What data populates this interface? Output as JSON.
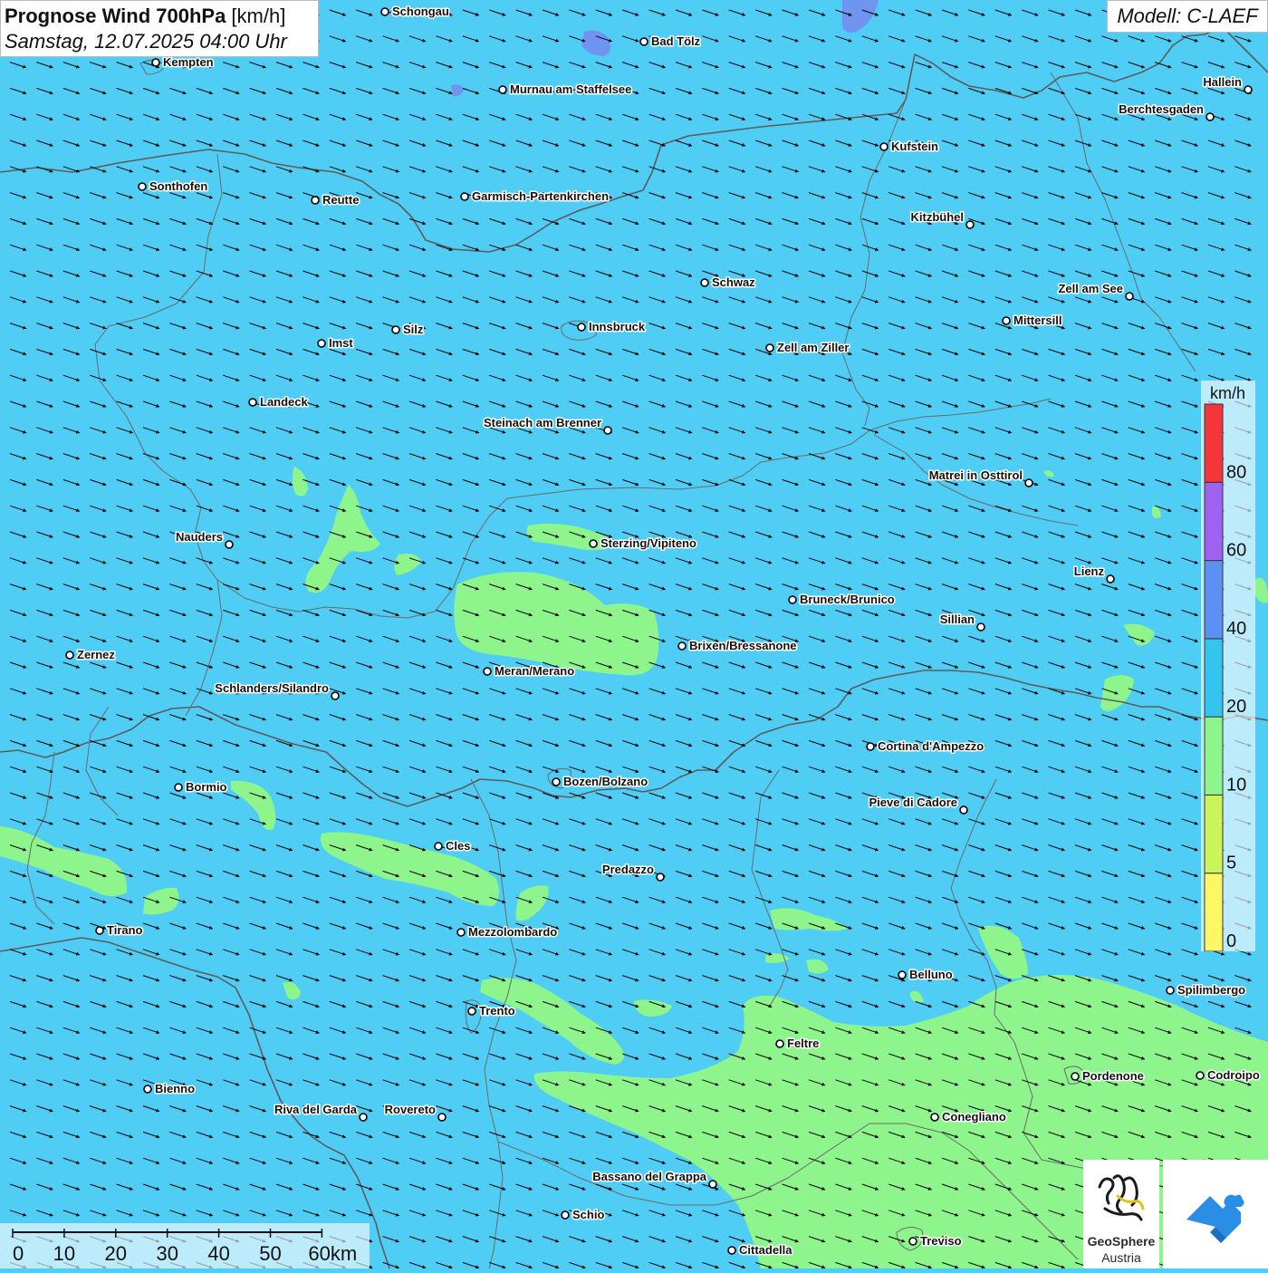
{
  "title": {
    "main_bold": "Prognose Wind 700hPa",
    "main_unit": " [km/h]",
    "datetime": "Samstag, 12.07.2025 04:00 Uhr"
  },
  "model_label": "Modell: C-LAEF",
  "legend": {
    "unit": "km/h",
    "classes": [
      {
        "from": 0,
        "to": 5,
        "color": "#fff766"
      },
      {
        "from": 5,
        "to": 10,
        "color": "#c9f55a"
      },
      {
        "from": 10,
        "to": 20,
        "color": "#8ef58c"
      },
      {
        "from": 20,
        "to": 40,
        "color": "#33c4ef"
      },
      {
        "from": 40,
        "to": 60,
        "color": "#5b92f2"
      },
      {
        "from": 60,
        "to": 80,
        "color": "#9f63ef"
      },
      {
        "from": 80,
        "to": 100,
        "color": "#f4353b"
      }
    ],
    "ticks": [
      "0",
      "5",
      "10",
      "20",
      "40",
      "60",
      "80"
    ]
  },
  "scale_bar": {
    "labels": [
      "0",
      "10",
      "20",
      "30",
      "40",
      "50",
      "60km"
    ]
  },
  "wind": {
    "prevailing_direction": "from west-northwest toward east-southeast",
    "dominant_speed_class": "20-40 km/h"
  },
  "cities": [
    {
      "name": "Schongau",
      "label_side": "right"
    },
    {
      "name": "Bad Tölz",
      "label_side": "right"
    },
    {
      "name": "Kempten",
      "label_side": "right"
    },
    {
      "name": "Murnau am Staffelsee",
      "label_side": "right"
    },
    {
      "name": "Hallein",
      "label_side": "left"
    },
    {
      "name": "Berchtesgaden",
      "label_side": "left"
    },
    {
      "name": "Kufstein",
      "label_side": "right"
    },
    {
      "name": "Sonthofen",
      "label_side": "right"
    },
    {
      "name": "Reutte",
      "label_side": "right"
    },
    {
      "name": "Garmisch-Partenkirchen",
      "label_side": "right"
    },
    {
      "name": "Kitzbühel",
      "label_side": "left"
    },
    {
      "name": "Schwaz",
      "label_side": "right"
    },
    {
      "name": "Zell am See",
      "label_side": "left"
    },
    {
      "name": "Innsbruck",
      "label_side": "right"
    },
    {
      "name": "Silz",
      "label_side": "right"
    },
    {
      "name": "Mittersill",
      "label_side": "right"
    },
    {
      "name": "Imst",
      "label_side": "right"
    },
    {
      "name": "Zell am Ziller",
      "label_side": "right"
    },
    {
      "name": "Landeck",
      "label_side": "right"
    },
    {
      "name": "Steinach am Brenner",
      "label_side": "left"
    },
    {
      "name": "Matrei in Osttirol",
      "label_side": "left"
    },
    {
      "name": "Nauders",
      "label_side": "left"
    },
    {
      "name": "Sterzing/Vipiteno",
      "label_side": "right"
    },
    {
      "name": "Lienz",
      "label_side": "left"
    },
    {
      "name": "Bruneck/Brunico",
      "label_side": "right"
    },
    {
      "name": "Sillian",
      "label_side": "left"
    },
    {
      "name": "Brixen/Bressanone",
      "label_side": "right"
    },
    {
      "name": "Zernez",
      "label_side": "right"
    },
    {
      "name": "Meran/Merano",
      "label_side": "right"
    },
    {
      "name": "Schlanders/Silandro",
      "label_side": "left"
    },
    {
      "name": "Cortina d'Ampezzo",
      "label_side": "right"
    },
    {
      "name": "Bozen/Bolzano",
      "label_side": "right"
    },
    {
      "name": "Bormio",
      "label_side": "right"
    },
    {
      "name": "Pieve di Cadore",
      "label_side": "left"
    },
    {
      "name": "Cles",
      "label_side": "right"
    },
    {
      "name": "Predazzo",
      "label_side": "left"
    },
    {
      "name": "Tirano",
      "label_side": "right"
    },
    {
      "name": "Mezzolombardo",
      "label_side": "right"
    },
    {
      "name": "Belluno",
      "label_side": "right"
    },
    {
      "name": "Spilimbergo",
      "label_side": "right"
    },
    {
      "name": "Trento",
      "label_side": "right"
    },
    {
      "name": "Feltre",
      "label_side": "right"
    },
    {
      "name": "Pordenone",
      "label_side": "right"
    },
    {
      "name": "Codroipo",
      "label_side": "right"
    },
    {
      "name": "Bienno",
      "label_side": "right"
    },
    {
      "name": "Riva del Garda",
      "label_side": "left"
    },
    {
      "name": "Rovereto",
      "label_side": "left"
    },
    {
      "name": "Conegliano",
      "label_side": "right"
    },
    {
      "name": "Bassano del Grappa",
      "label_side": "left"
    },
    {
      "name": "Schio",
      "label_side": "right"
    },
    {
      "name": "Treviso",
      "label_side": "right"
    },
    {
      "name": "Cittadella",
      "label_side": "right"
    }
  ],
  "logos": {
    "geosphere_name": "GeoSphere",
    "geosphere_sub": "Austria"
  },
  "colors": {
    "background_20_40": "#4fcdf4",
    "patch_10_20": "#8ef58c",
    "lake": "#6f95f0",
    "border": "#5c5c5c",
    "arrow": "#000000"
  }
}
